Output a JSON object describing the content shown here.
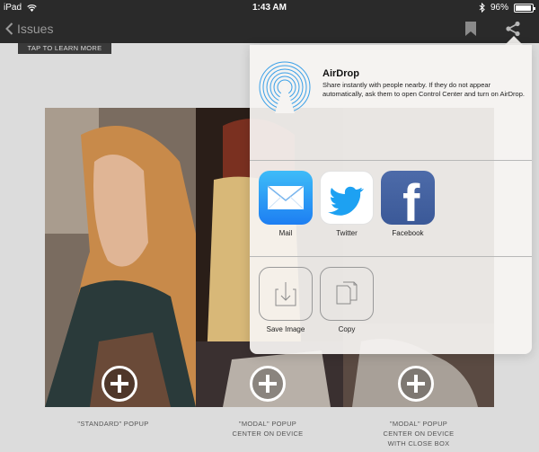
{
  "status_bar": {
    "device": "iPad",
    "time": "1:43 AM",
    "battery": "96%",
    "battery_level": 0.96
  },
  "nav": {
    "back_label": "Issues"
  },
  "tap_label": "TAP TO LEARN MORE",
  "captions": [
    {
      "lines": [
        "\"STANDARD\" POPUP"
      ]
    },
    {
      "lines": [
        "\"MODAL\" POPUP",
        "CENTER ON DEVICE"
      ]
    },
    {
      "lines": [
        "\"MODAL\" POPUP",
        "CENTER ON DEVICE",
        "WITH CLOSE BOX"
      ]
    }
  ],
  "share_sheet": {
    "airdrop_title": "AirDrop",
    "airdrop_description": "Share instantly with people nearby. If they do not appear automatically, ask them to open Control Center and turn on AirDrop.",
    "apps": [
      {
        "label": "Mail",
        "icon": "mail-icon",
        "color": "#1d7ef2"
      },
      {
        "label": "Twitter",
        "icon": "twitter-icon",
        "color": "#1da1f2"
      },
      {
        "label": "Facebook",
        "icon": "facebook-icon",
        "color": "#3b5998"
      }
    ],
    "actions": [
      {
        "label": "Save Image",
        "icon": "save-image-icon"
      },
      {
        "label": "Copy",
        "icon": "copy-icon"
      }
    ]
  },
  "colors": {
    "bar_background": "#2a2a2a",
    "page_background": "#dcdcdc",
    "airdrop_blue": "#3aa0e8"
  }
}
